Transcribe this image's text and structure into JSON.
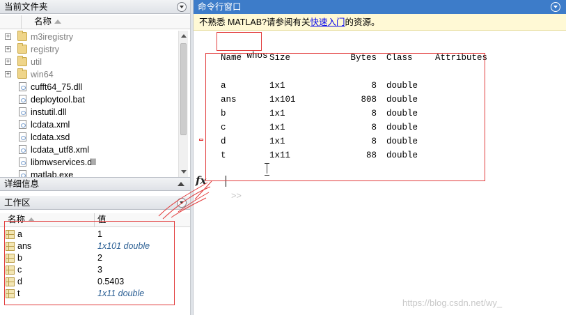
{
  "current_folder": {
    "title": "当前文件夹",
    "column_name": "名称",
    "files": [
      {
        "name": "m3iregistry",
        "type": "folder",
        "expandable": true,
        "dim": true
      },
      {
        "name": "registry",
        "type": "folder",
        "expandable": true,
        "dim": true
      },
      {
        "name": "util",
        "type": "folder",
        "expandable": true,
        "dim": true
      },
      {
        "name": "win64",
        "type": "folder",
        "expandable": true,
        "dim": true
      },
      {
        "name": "cufft64_75.dll",
        "type": "file",
        "expandable": false,
        "dim": false
      },
      {
        "name": "deploytool.bat",
        "type": "file",
        "expandable": false,
        "dim": false
      },
      {
        "name": "instutil.dll",
        "type": "file",
        "expandable": false,
        "dim": false
      },
      {
        "name": "lcdata.xml",
        "type": "file",
        "expandable": false,
        "dim": false
      },
      {
        "name": "lcdata.xsd",
        "type": "file",
        "expandable": false,
        "dim": false
      },
      {
        "name": "lcdata_utf8.xml",
        "type": "file",
        "expandable": false,
        "dim": false
      },
      {
        "name": "libmwservices.dll",
        "type": "file",
        "expandable": false,
        "dim": false
      },
      {
        "name": "matlab.exe",
        "type": "file",
        "expandable": false,
        "dim": false
      }
    ]
  },
  "details": {
    "title": "详细信息"
  },
  "workspace": {
    "title": "工作区",
    "col_name": "名称",
    "col_value": "值",
    "variables": [
      {
        "name": "a",
        "value": "1",
        "italic": false
      },
      {
        "name": "ans",
        "value": "1x101 double",
        "italic": true
      },
      {
        "name": "b",
        "value": "2",
        "italic": false
      },
      {
        "name": "c",
        "value": "3",
        "italic": false
      },
      {
        "name": "d",
        "value": "0.5403",
        "italic": false
      },
      {
        "name": "t",
        "value": "1x11 double",
        "italic": true
      }
    ]
  },
  "command_window": {
    "title": "命令行窗口",
    "notice_prefix": "不熟悉 MATLAB?请参阅有关",
    "notice_link": "快速入门",
    "notice_suffix": "的资源。",
    "prompt": ">>",
    "command": "whos",
    "whos_headers": {
      "name": "Name",
      "size": "Size",
      "bytes": "Bytes",
      "class": "Class",
      "attributes": "Attributes"
    },
    "whos_rows": [
      {
        "name": "a",
        "size": "1x1",
        "bytes": "8",
        "class": "double"
      },
      {
        "name": "ans",
        "size": "1x101",
        "bytes": "808",
        "class": "double"
      },
      {
        "name": "b",
        "size": "1x1",
        "bytes": "8",
        "class": "double"
      },
      {
        "name": "c",
        "size": "1x1",
        "bytes": "8",
        "class": "double"
      },
      {
        "name": "d",
        "size": "1x1",
        "bytes": "8",
        "class": "double"
      },
      {
        "name": "t",
        "size": "1x11",
        "bytes": "88",
        "class": "double"
      }
    ],
    "fx_label": "fx"
  },
  "watermark": "https://blog.csdn.net/wy_",
  "colors": {
    "header_blue": "#3d7cc9",
    "annotation_red": "#e23b3b",
    "notice_bg": "#fff9d5"
  }
}
